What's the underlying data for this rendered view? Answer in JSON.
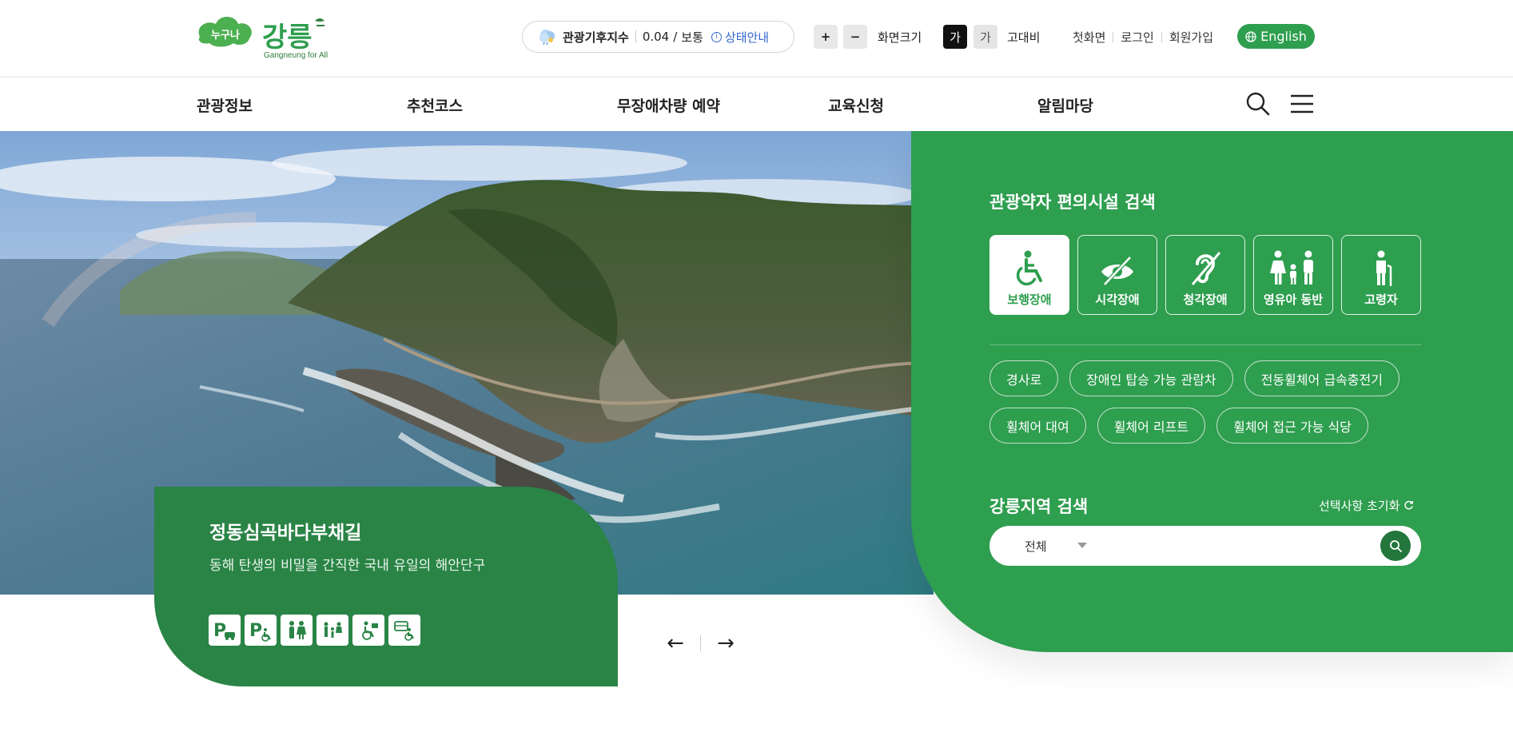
{
  "header": {
    "logo_text_kor": "누구나 강릉",
    "logo_sub": "Gangneung for All",
    "climate": {
      "label": "관광기후지수",
      "value": "0.04",
      "slash": "/",
      "status": "보통",
      "info_label": "상태안내"
    },
    "zoom_in": "+",
    "zoom_out": "−",
    "zoom_label": "화면크기",
    "contrast_dark": "가",
    "contrast_light": "가",
    "contrast_label": "고대비",
    "util": [
      "첫화면",
      "로그인",
      "회원가입"
    ],
    "language": "English"
  },
  "nav": {
    "items": [
      "관광정보",
      "추천코스",
      "무장애차량 예약",
      "교육신청",
      "알림마당"
    ]
  },
  "hero": {
    "title": "정동심곡바다부채길",
    "description": "동해 탄생의 비밀을 간직한 국내 유일의 해안단구",
    "facilities": [
      "parking-car-icon",
      "accessible-parking-icon",
      "restroom-icon",
      "family-restroom-icon",
      "wheelchair-service-icon",
      "accessible-bus-icon"
    ],
    "prev": "←",
    "next": "→"
  },
  "panel": {
    "title": "관광약자 편의시설 검색",
    "categories": [
      {
        "label": "보행장애",
        "icon": "wheelchair-icon",
        "active": true
      },
      {
        "label": "시각장애",
        "icon": "visual-impairment-icon",
        "active": false
      },
      {
        "label": "청각장애",
        "icon": "hearing-impairment-icon",
        "active": false
      },
      {
        "label": "영유아 동반",
        "icon": "family-icon",
        "active": false
      },
      {
        "label": "고령자",
        "icon": "elderly-icon",
        "active": false
      }
    ],
    "chips": [
      "경사로",
      "장애인 탑승 가능 관람차",
      "전동휠체어 급속충전기",
      "휠체어 대여",
      "휠체어 리프트",
      "휠체어 접근 가능 식당"
    ],
    "region_title": "강릉지역 검색",
    "reset_label": "선택사항 초기화",
    "region_select": "전체",
    "search_placeholder": ""
  },
  "colors": {
    "brand_green": "#2e9e4f",
    "dark_green": "#2a8446"
  }
}
